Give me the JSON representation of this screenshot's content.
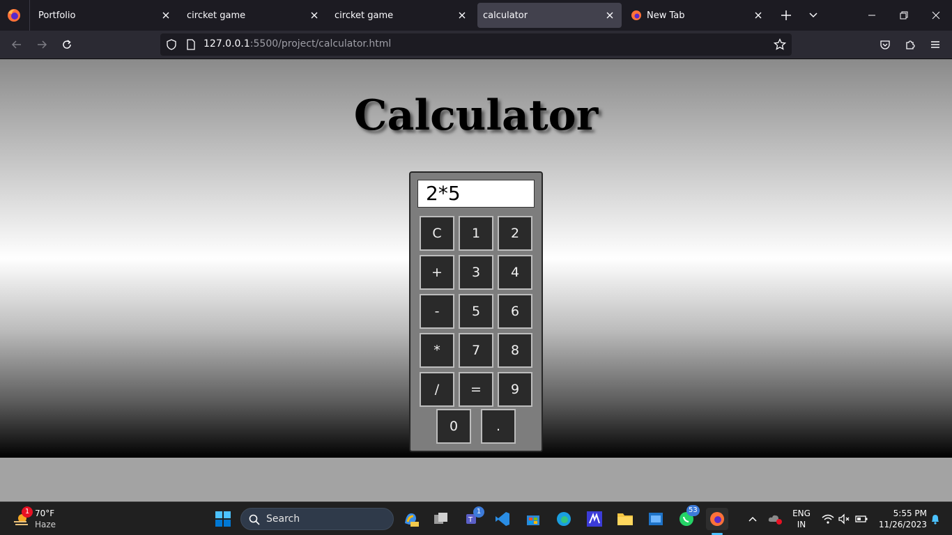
{
  "browser": {
    "tabs": [
      {
        "title": "Portfolio",
        "active": false
      },
      {
        "title": "circket game",
        "active": false
      },
      {
        "title": "circket game",
        "active": false
      },
      {
        "title": "calculator",
        "active": true
      },
      {
        "title": "New Tab",
        "active": false
      }
    ],
    "url_host": "127.0.0.1",
    "url_rest": ":5500/project/calculator.html"
  },
  "page": {
    "heading": "Calculator",
    "display_value": "2*5",
    "keys": [
      "C",
      "1",
      "2",
      "+",
      "3",
      "4",
      "-",
      "5",
      "6",
      "*",
      "7",
      "8",
      "/",
      "=",
      "9",
      "0",
      "."
    ]
  },
  "taskbar": {
    "weather_temp": "70°F",
    "weather_desc": "Haze",
    "weather_badge": "1",
    "search_label": "Search",
    "teams_badge": "1",
    "whatsapp_badge": "53",
    "language": "ENG",
    "region": "IN",
    "time": "5:55 PM",
    "date": "11/26/2023"
  },
  "colors": {
    "accent_active_tab": "#42414d",
    "page_gradient_top": "#8a8a8a",
    "calc_body": "#7d7d7d",
    "key_bg": "#2a2a2a"
  }
}
